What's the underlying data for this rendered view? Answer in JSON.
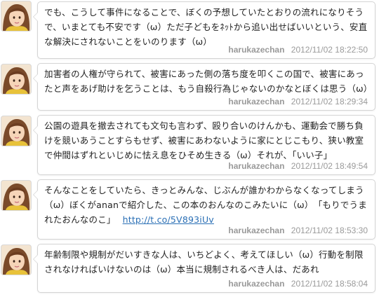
{
  "tweets": [
    {
      "text": "でも、こうして事件になることで、ぼくの予想していたとおりの流れになりそうで、いまとても不安です（ω）ただ子どもをﾈｯﾄから追い出せばいいという、安直な解決にされないことをいのります（ω）",
      "link": "",
      "user": "harukazechan",
      "timestamp": "2012/11/02 18:22:50"
    },
    {
      "text": "加害者の人権が守られて、被害にあった側の落ち度を叩くこの国で、被害にあったと声をあげ助けを乞うことは、もう自殺行為じゃないのかなとぼくは思う（ω）",
      "link": "",
      "user": "harukazechan",
      "timestamp": "2012/11/02 18:29:34"
    },
    {
      "text": "公園の遊具を撤去されても文句も言わず、殴り合いのけんかも、運動会で勝ち負けを競いあうことすらもせず、被害にあわないように家にとじこもり、狭い教室で仲間はずれといじめに怯え息をひそめ生きる（ω）それが、「いい子」",
      "link": "",
      "user": "harukazechan",
      "timestamp": "2012/11/02 18:49:54"
    },
    {
      "text": "そんなことをしていたら、きっとみんな、じぶんが誰かわからなくなってしまう（ω）ぼくがananで紹介した、この本のおんなのこみたいに（ω）　「もりでうまれたおんなのこ」",
      "link": "http://t.co/5V893iUv",
      "user": "harukazechan",
      "timestamp": "2012/11/02 18:53:30"
    },
    {
      "text": "年齢制限や規制がだいすきな人は、いちどよく、考えてほしい（ω）行動を制限されなければいけないのは（ω）本当に規制されるべき人は、だあれ",
      "link": "",
      "user": "harukazechan",
      "timestamp": "2012/11/02 18:58:04"
    }
  ],
  "colors": {
    "text": "#222222",
    "meta": "#9a9a9a",
    "link": "#2a6fb5",
    "border": "#d4d4d4"
  },
  "icons": {
    "avatar": "user-avatar-photo"
  }
}
